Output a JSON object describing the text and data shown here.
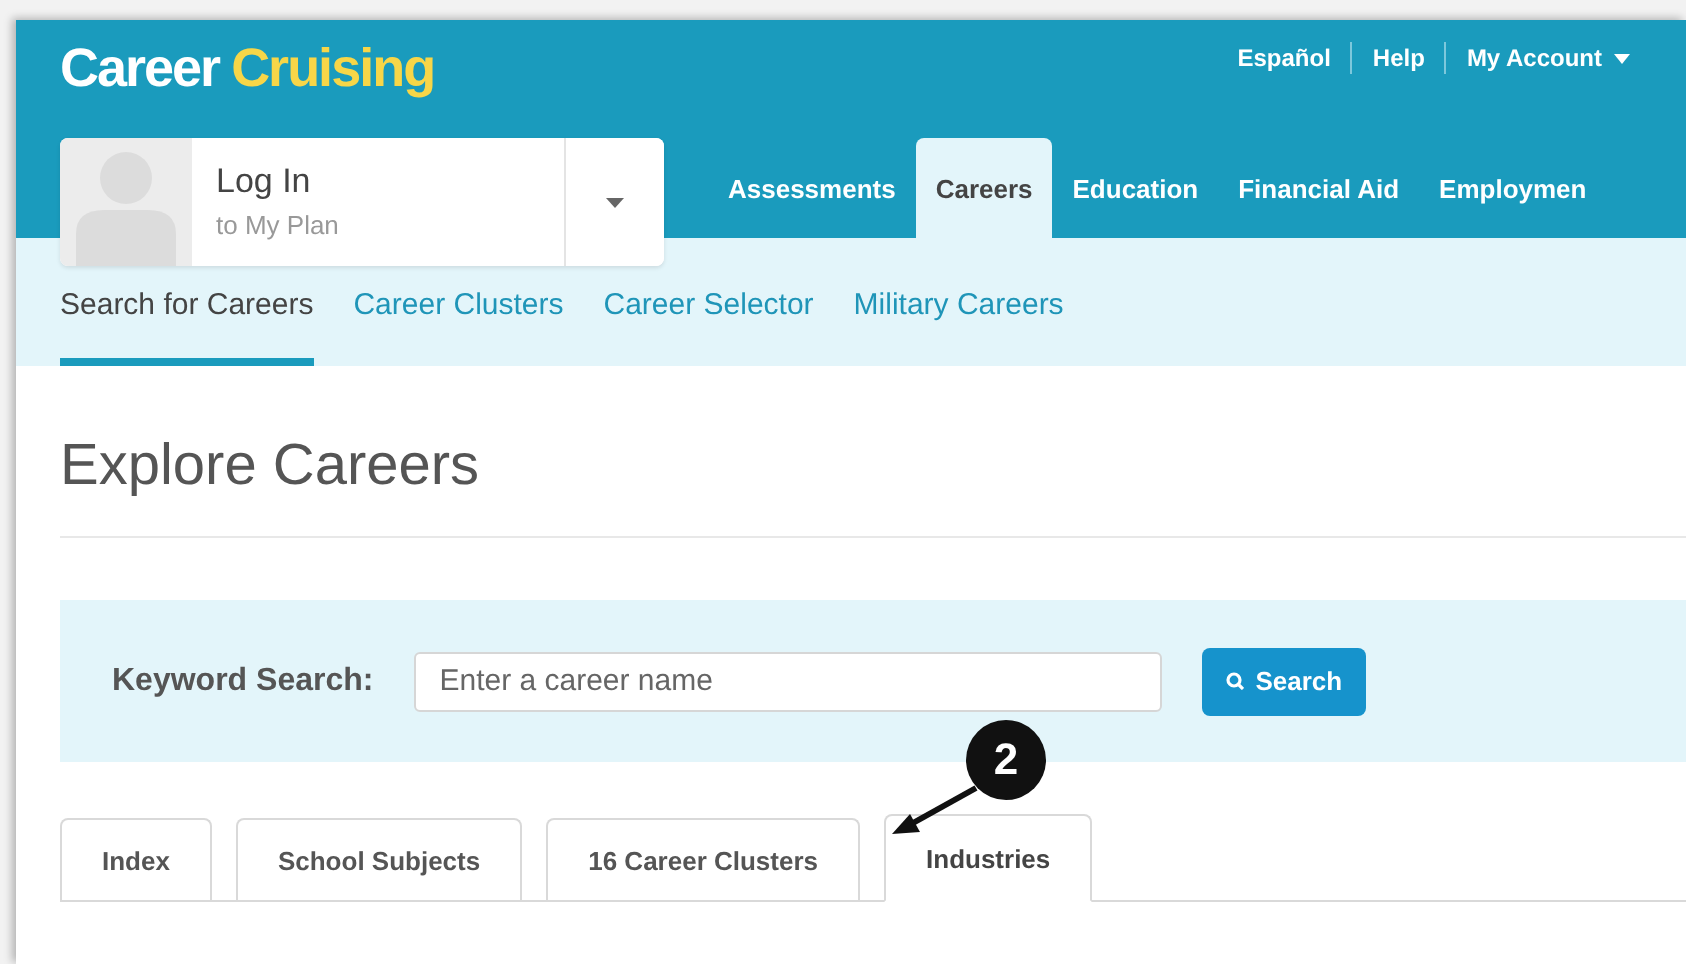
{
  "logo": {
    "part_1": "Career",
    "part_2": "Cruising"
  },
  "top_links": [
    "Español",
    "Help",
    "My Account"
  ],
  "login": {
    "title": "Log In",
    "subtitle": "to My Plan"
  },
  "main_nav": [
    {
      "label": "Assessments",
      "selected": false
    },
    {
      "label": "Careers",
      "selected": true
    },
    {
      "label": "Education",
      "selected": false
    },
    {
      "label": "Financial Aid",
      "selected": false
    },
    {
      "label": "Employmen",
      "selected": false
    }
  ],
  "sub_nav": [
    {
      "label": "Search for Careers",
      "selected": true
    },
    {
      "label": "Career Clusters",
      "selected": false
    },
    {
      "label": "Career Selector",
      "selected": false
    },
    {
      "label": "Military Careers",
      "selected": false
    }
  ],
  "heading": "Explore Careers",
  "search": {
    "label": "Keyword Search:",
    "placeholder": "Enter a career name",
    "button": "Search"
  },
  "tabs": [
    {
      "label": "Index",
      "selected": false
    },
    {
      "label": "School Subjects",
      "selected": false
    },
    {
      "label": "16 Career Clusters",
      "selected": false
    },
    {
      "label": "Industries",
      "selected": true
    }
  ],
  "annotation": {
    "label": "2"
  }
}
